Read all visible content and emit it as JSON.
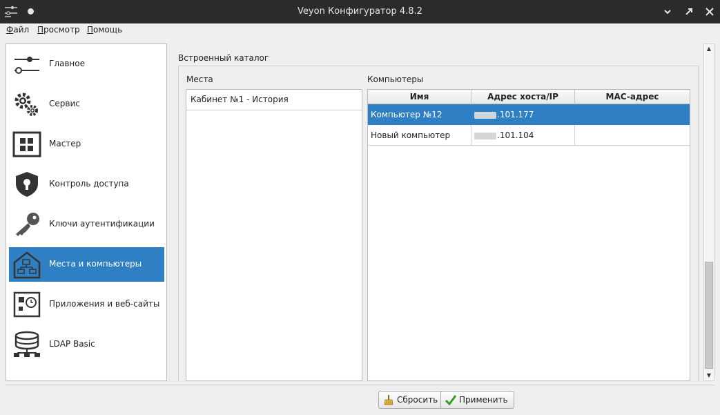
{
  "window": {
    "title": "Veyon Конфигуратор 4.8.2"
  },
  "menu": {
    "file": "Файл",
    "view": "Просмотр",
    "help": "Помощь"
  },
  "nav": {
    "items": [
      {
        "label": "Главное",
        "icon": "sliders-icon"
      },
      {
        "label": "Сервис",
        "icon": "gears-icon"
      },
      {
        "label": "Мастер",
        "icon": "grid-window-icon"
      },
      {
        "label": "Контроль доступа",
        "icon": "shield-lock-icon"
      },
      {
        "label": "Ключи аутентификации",
        "icon": "key-icon"
      },
      {
        "label": "Места и компьютеры",
        "icon": "house-network-icon",
        "active": true
      },
      {
        "label": "Приложения и веб-сайты",
        "icon": "app-clock-icon"
      },
      {
        "label": "LDAP Basic",
        "icon": "database-network-icon"
      }
    ]
  },
  "content": {
    "section_title": "Встроенный каталог",
    "locations_label": "Места",
    "computers_label": "Компьютеры",
    "locations": [
      "Кабинет №1 - История"
    ],
    "table": {
      "headers": [
        "Имя",
        "Адрес хоста/IP",
        "MAC-адрес"
      ],
      "rows": [
        {
          "name": "Компьютер №12",
          "ip": ".101.177",
          "mac": "",
          "selected": true
        },
        {
          "name": "Новый компьютер",
          "ip": ".101.104",
          "mac": "",
          "selected": false
        }
      ]
    }
  },
  "buttons": {
    "reset": "Сбросить",
    "apply": "Применить"
  },
  "colors": {
    "accent": "#2f7fc4",
    "titlebar": "#2b2b2b"
  }
}
